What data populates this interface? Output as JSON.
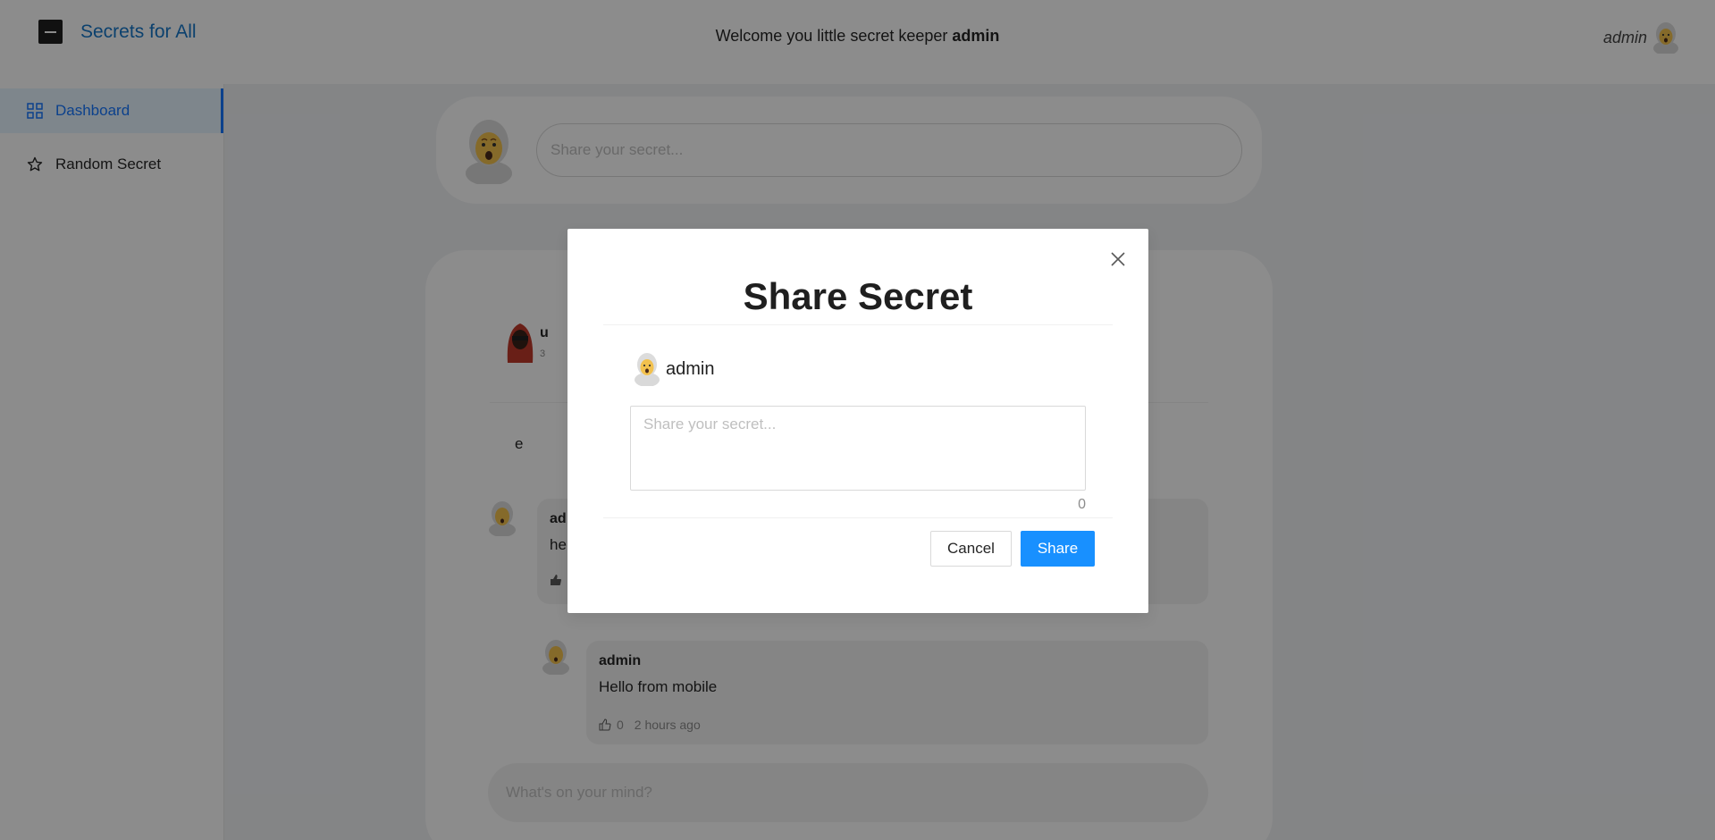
{
  "header": {
    "brand": "Secrets for All",
    "welcome_prefix": "Welcome you little secret keeper ",
    "welcome_user": "admin",
    "current_user": "admin"
  },
  "sidebar": {
    "items": [
      {
        "label": "Dashboard",
        "icon": "dashboard-icon",
        "active": true
      },
      {
        "label": "Random Secret",
        "icon": "star-icon",
        "active": false
      }
    ]
  },
  "composer": {
    "placeholder": "Share your secret..."
  },
  "feed": {
    "post": {
      "author_partial": "u",
      "time_partial": "3",
      "text": "e"
    },
    "comments": [
      {
        "author": "ad",
        "text": "he",
        "likes": "",
        "time": ""
      },
      {
        "author": "admin",
        "text": "Hello from mobile",
        "likes": "0",
        "time": "2 hours ago"
      }
    ],
    "mind_placeholder": "What's on your mind?"
  },
  "modal": {
    "title": "Share Secret",
    "user": "admin",
    "placeholder": "Share your secret...",
    "count": "0",
    "cancel_label": "Cancel",
    "share_label": "Share"
  },
  "colors": {
    "primary": "#1890ff",
    "brand": "#1677c9",
    "overlay": "rgba(0,0,0,0.45)"
  }
}
